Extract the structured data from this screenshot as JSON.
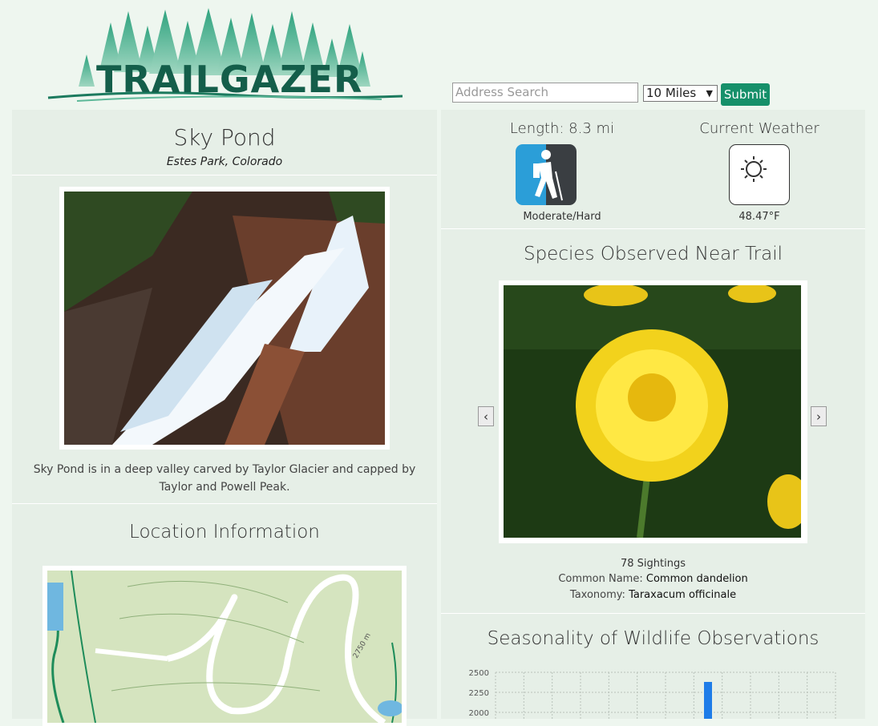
{
  "header": {
    "logo_text": "TRAILGAZER",
    "search_placeholder": "Address Search",
    "distance_selected": "10 Miles",
    "submit_label": "Submit"
  },
  "trail": {
    "name": "Sky Pond",
    "location": "Estes Park, Colorado",
    "description": "Sky Pond is in a deep valley carved by Taylor Glacier and capped by Taylor and Powell Peak.",
    "length": "Length: 8.3 mi",
    "difficulty": "Moderate/Hard"
  },
  "weather": {
    "heading": "Current Weather",
    "temperature": "48.47°F",
    "icon": "sun-icon"
  },
  "location_info": {
    "heading": "Location Information",
    "map_label": "2750 m"
  },
  "species": {
    "heading": "Species Observed Near Trail",
    "sightings": "78 Sightings",
    "common_label": "Common Name:",
    "common_value": "Common dandelion",
    "taxonomy_label": "Taxonomy:",
    "taxonomy_value": "Taraxacum officinale",
    "prev_label": "‹",
    "next_label": "›"
  },
  "seasonality": {
    "heading": "Seasonality of Wildlife Observations"
  },
  "chart_data": {
    "type": "bar",
    "title": "Seasonality of Wildlife Observations",
    "y_ticks": [
      "2500",
      "2250",
      "2000"
    ],
    "ylim": [
      1900,
      2500
    ],
    "bar_index": 7,
    "bar_value": 2380,
    "grid": true,
    "bar_color": "#1e7ce8"
  },
  "colors": {
    "accent": "#16906a",
    "background": "#eef6ef",
    "panel": "#e6efe7",
    "logo_dark": "#145e4a",
    "logo_light": "#2fa37f"
  }
}
